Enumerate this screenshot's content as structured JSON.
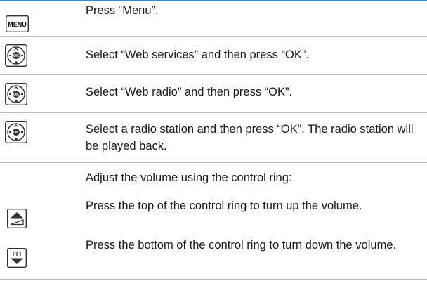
{
  "steps": [
    {
      "icon": "menu-key-icon",
      "icon_label": "MENU",
      "text": "Press “Menu”."
    },
    {
      "icon": "navigation-key-icon",
      "text": "Select “Web services” and then press “OK”."
    },
    {
      "icon": "navigation-key-icon",
      "text": "Select “Web radio” and then press “OK”."
    },
    {
      "icon": "navigation-key-icon",
      "text": "Select a radio station and then press “OK”. The radio station will be played back."
    },
    {
      "icon": "",
      "text": "Adjust the volume using the control ring:"
    },
    {
      "icon": "volume-up-icon",
      "text": "Press the top of the control ring to turn up the volume."
    },
    {
      "icon": "volume-down-icon",
      "text": "Press the bottom of the control ring to turn down the volume."
    }
  ],
  "nav_key_label": "OK",
  "colors": {
    "accent_rule": "#2a8ad4",
    "divider": "#bdbdbd",
    "text": "#1a1a1a"
  }
}
